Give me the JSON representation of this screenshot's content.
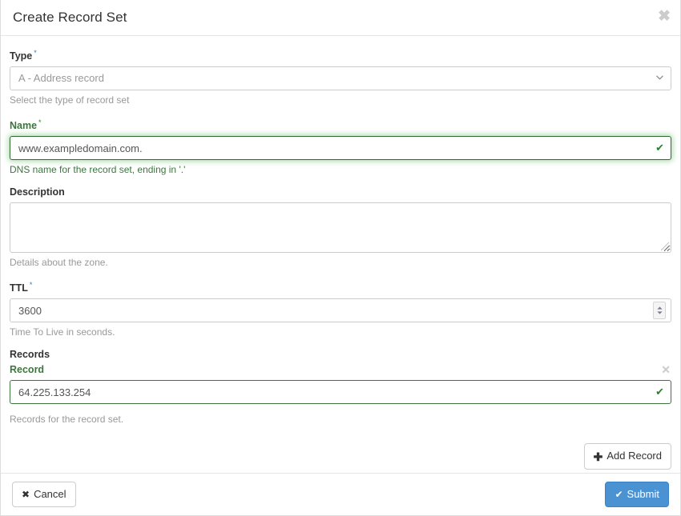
{
  "header": {
    "title": "Create Record Set",
    "close_label": "✖"
  },
  "form": {
    "type": {
      "label": "Type",
      "required_marker": "*",
      "value": "A - Address record",
      "help": "Select the type of record set",
      "options": [
        "A - Address record"
      ],
      "chevron_icon": "chevron-down-icon"
    },
    "name": {
      "label": "Name",
      "required_marker": "*",
      "value": "www.exampledomain.com.",
      "help": "DNS name for the record set, ending in '.'",
      "state": "valid",
      "check_icon": "✔"
    },
    "description": {
      "label": "Description",
      "value": "",
      "placeholder": "",
      "help": "Details about the zone."
    },
    "ttl": {
      "label": "TTL",
      "required_marker": "*",
      "value": "3600",
      "help": "Time To Live in seconds."
    },
    "records": {
      "section_label": "Records",
      "item_label": "Record",
      "value": "64.225.133.254",
      "remove_label": "✕",
      "check_icon": "✔",
      "help": "Records for the record set.",
      "add_button": "Add Record",
      "add_icon": "✚"
    }
  },
  "footer": {
    "cancel_label": "Cancel",
    "cancel_icon": "✖",
    "submit_label": "Submit",
    "submit_icon": "✔"
  },
  "colors": {
    "valid_green": "#3c763d",
    "required_blue": "#337ab7",
    "primary_blue": "#4b92d3",
    "muted": "#999999"
  }
}
